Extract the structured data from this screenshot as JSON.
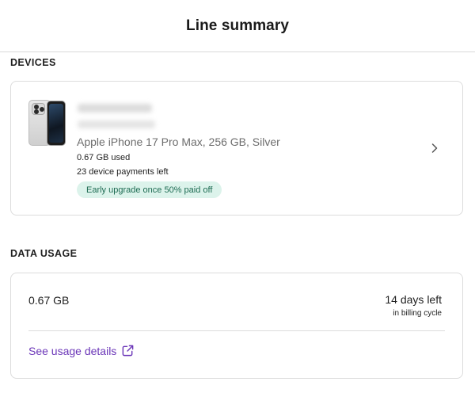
{
  "header": {
    "title": "Line summary"
  },
  "devices": {
    "heading": "DEVICES",
    "device": {
      "model": "Apple iPhone 17 Pro Max, 256 GB, Silver",
      "data_used": "0.67 GB used",
      "payments_left": "23 device payments left",
      "upgrade_badge": "Early upgrade once 50% paid off",
      "icons": {
        "device_image": "iphone-image",
        "navigate": "chevron-right-icon"
      }
    }
  },
  "data_usage": {
    "heading": "DATA USAGE",
    "amount": "0.67 GB",
    "days_left": "14 days left",
    "billing_cycle": "in billing cycle",
    "details_link": "See usage details",
    "icons": {
      "external_link": "external-link-icon"
    }
  },
  "colors": {
    "link": "#6b36b8",
    "badge_bg": "#dcf3eb",
    "badge_text": "#1d6b52"
  }
}
